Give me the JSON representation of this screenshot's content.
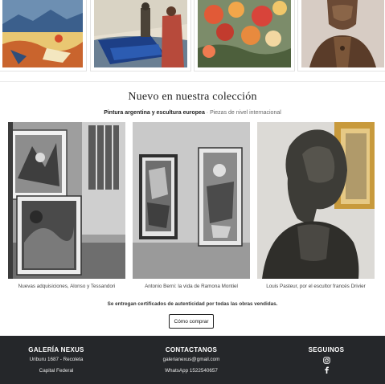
{
  "gallery_thumbnails": [
    {
      "name": "harbor-painting",
      "alt": ""
    },
    {
      "name": "fisherman-painting",
      "alt": ""
    },
    {
      "name": "flowers-painting",
      "alt": ""
    },
    {
      "name": "bronze-bust",
      "alt": ""
    }
  ],
  "collection": {
    "title": "Nuevo en nuestra colección",
    "subtitle_bold": "Pintura argentina y escultura europea",
    "subtitle_rest": " · Piezas de nivel internacional",
    "items": [
      {
        "caption": "Nuevas adquisiciones, Alonso y Tessandori"
      },
      {
        "caption": "Antonio Berni: la vida de Ramona Montiel"
      },
      {
        "caption": "Louis Pasteur, por el escultor francés Drivier"
      }
    ],
    "certificate_note": "Se entregan certificados de autenticidad por todas las obras vendidas.",
    "buy_button": "Cómo comprar"
  },
  "footer": {
    "gallery": {
      "title": "GALERÍA NEXUS",
      "address_line1": "Uriburu 1687 - Recoleta",
      "address_line2": "Capital Federal"
    },
    "contact": {
      "title": "CONTACTANOS",
      "email": "galerianexus@gmail.com",
      "whatsapp": "WhatsApp 1522540657"
    },
    "follow": {
      "title": "SEGUINOS",
      "icons": [
        "instagram-icon",
        "facebook-icon"
      ]
    },
    "background": "#25272a"
  }
}
